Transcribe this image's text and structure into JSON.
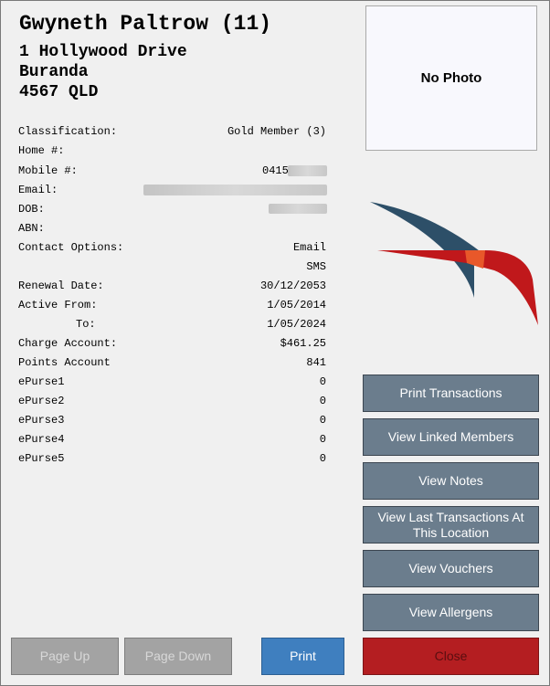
{
  "member": {
    "name": "Gwyneth Paltrow (11)",
    "address_line1": "1 Hollywood Drive",
    "address_line2": "Buranda",
    "address_line3": "4567 QLD"
  },
  "details": [
    {
      "label": "Classification:",
      "value": "Gold Member (3)"
    },
    {
      "label": "Home #:",
      "value": ""
    },
    {
      "label": "Mobile #:",
      "value": "0415"
    },
    {
      "label": "Email:",
      "value": ""
    },
    {
      "label": "DOB:",
      "value": ""
    },
    {
      "label": "ABN:",
      "value": ""
    },
    {
      "label": "Contact Options:",
      "value": "Email"
    },
    {
      "label": "",
      "value": "SMS"
    },
    {
      "label": "Renewal Date:",
      "value": "30/12/2053"
    },
    {
      "label": "Active From:",
      "value": "1/05/2014"
    },
    {
      "label": "To:",
      "value": "1/05/2024"
    },
    {
      "label": "Charge Account:",
      "value": "$461.25"
    },
    {
      "label": "Points Account",
      "value": "841"
    },
    {
      "label": "ePurse1",
      "value": "0"
    },
    {
      "label": "ePurse2",
      "value": "0"
    },
    {
      "label": "ePurse3",
      "value": "0"
    },
    {
      "label": "ePurse4",
      "value": "0"
    },
    {
      "label": "ePurse5",
      "value": "0"
    }
  ],
  "photo": {
    "placeholder": "No Photo"
  },
  "logo": {
    "icon": "bird-logo-icon",
    "colors": {
      "dark": "#2d4f68",
      "red": "#c0181b",
      "orange": "#e8582a"
    }
  },
  "side_buttons": {
    "print_transactions": "Print Transactions",
    "view_linked_members": "View Linked Members",
    "view_notes": "View Notes",
    "view_last_transactions": "View Last Transactions At This Location",
    "view_vouchers": "View Vouchers",
    "view_allergens": "View Allergens"
  },
  "bottom_buttons": {
    "page_up": "Page Up",
    "page_down": "Page Down",
    "print": "Print",
    "close": "Close"
  },
  "colors": {
    "panel": "#f0f0f0",
    "button": "#6b7d8d",
    "print": "#3f7fbf",
    "close": "#b41e21"
  }
}
